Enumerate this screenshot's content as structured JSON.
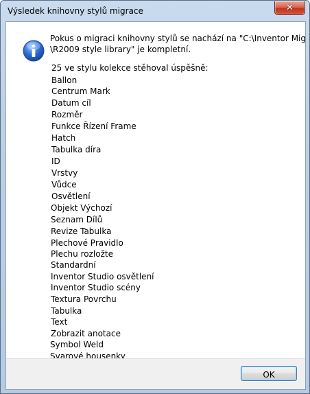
{
  "window": {
    "title": "Výsledek knihovny stylů migrace",
    "close_glyph": "✕"
  },
  "dialog": {
    "icon": "information-icon",
    "message_lines": [
      "Pokus o migraci knihovny stylů se nachází na  \"C:\\Inventor Migration",
      "\\R2009 style library\" je kompletní."
    ],
    "summary": "25 ve stylu kolekce stěhoval úspěšně:",
    "styles": [
      "Ballon",
      "Centrum Mark",
      "Datum cíl",
      "Rozměr",
      "Funkce Řízení Frame",
      "Hatch",
      "Tabulka díra",
      "ID",
      "Vrstvy",
      "Vůdce",
      "Osvětlení",
      "Objekt Výchozí",
      "Seznam Dílů",
      "Revize Tabulka",
      "Plechové Pravidlo",
      "Plechu rozložte",
      "Standardní",
      "Inventor Studio osvětlení",
      "Inventor Studio scény",
      "Textura Povrchu",
      "Tabulka",
      "Text",
      "Zobrazit anotace",
      "Symbol Weld",
      "Svarové housenky"
    ]
  },
  "buttons": {
    "ok_label": "OK"
  },
  "colors": {
    "accent_blue": "#3c7fb1",
    "close_red": "#c2331d",
    "frame_blue": "#bcd0e7"
  }
}
